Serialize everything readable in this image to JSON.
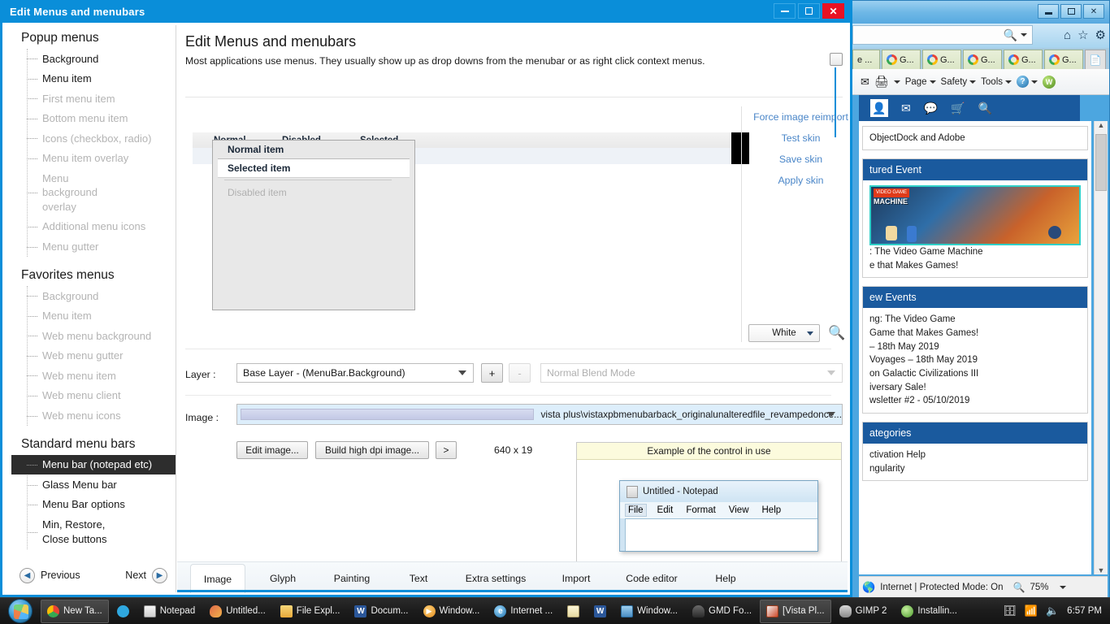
{
  "browser": {
    "tabs": [
      {
        "label": "e ...",
        "icon": "globe-icon"
      },
      {
        "label": "G...",
        "icon": "google-icon"
      },
      {
        "label": "G...",
        "icon": "google-icon"
      },
      {
        "label": "G...",
        "icon": "google-icon"
      },
      {
        "label": "G...",
        "icon": "google-icon"
      },
      {
        "label": "G...",
        "icon": "google-icon"
      }
    ],
    "command_bar": [
      "Page",
      "Safety",
      "Tools"
    ],
    "page": {
      "top_snippet": "ObjectDock and Adobe",
      "cards": [
        {
          "title": "tured Event",
          "has_image": true,
          "lines": [
            ": The Video Game Machine",
            "e that Makes Games!"
          ]
        },
        {
          "title": "ew Events",
          "has_image": false,
          "lines": [
            "ng: The Video Game",
            "Game that Makes Games!",
            "– 18th May 2019",
            "Voyages – 18th May 2019",
            " on Galactic Civilizations III",
            "iversary Sale!",
            "wsletter #2 - 05/10/2019"
          ]
        },
        {
          "title": "ategories",
          "has_image": false,
          "lines": [
            "ctivation Help",
            "ngularity"
          ]
        }
      ]
    },
    "status": {
      "zone": "Internet | Protected Mode: On",
      "zoom": "75%"
    }
  },
  "window": {
    "title": "Edit Menus and menubars",
    "minimize_label": "Minimize",
    "maximize_label": "Maximize",
    "close_label": "✕"
  },
  "sidebar": {
    "groups": [
      {
        "title": "Popup menus",
        "items": [
          {
            "label": "Background",
            "state": "normal"
          },
          {
            "label": "Menu item",
            "state": "normal"
          },
          {
            "label": "First menu item",
            "state": "dim"
          },
          {
            "label": "Bottom menu item",
            "state": "dim"
          },
          {
            "label": "Icons (checkbox, radio)",
            "state": "dim"
          },
          {
            "label": "Menu item overlay",
            "state": "dim"
          },
          {
            "label": "Menu background overlay",
            "state": "dim"
          },
          {
            "label": "Additional menu icons",
            "state": "dim"
          },
          {
            "label": "Menu gutter",
            "state": "dim"
          }
        ]
      },
      {
        "title": "Favorites menus",
        "items": [
          {
            "label": "Background",
            "state": "dim"
          },
          {
            "label": "Menu item",
            "state": "dim"
          },
          {
            "label": "Web menu background",
            "state": "dim"
          },
          {
            "label": "Web menu gutter",
            "state": "dim"
          },
          {
            "label": "Web menu item",
            "state": "dim"
          },
          {
            "label": "Web menu client",
            "state": "dim"
          },
          {
            "label": "Web menu icons",
            "state": "dim"
          }
        ]
      },
      {
        "title": "Standard menu bars",
        "items": [
          {
            "label": "Menu bar (notepad etc)",
            "state": "selected"
          },
          {
            "label": "Glass Menu bar",
            "state": "normal"
          },
          {
            "label": "Menu Bar options",
            "state": "normal"
          },
          {
            "label": "Min, Restore, Close buttons",
            "state": "normal"
          }
        ]
      }
    ],
    "nav": {
      "previous": "Previous",
      "next": "Next"
    }
  },
  "page": {
    "title": "Edit Menus and menubars",
    "subtitle": "Most applications use menus.  They usually show up as drop downs from the menubar or as right click context menus."
  },
  "preview": {
    "columns": [
      "Normal",
      "Disabled",
      "Selected"
    ],
    "menu_items": [
      {
        "label": "Normal item",
        "state": "normal"
      },
      {
        "label": "Selected item",
        "state": "selected"
      },
      {
        "label": "Disabled item",
        "state": "disabled"
      }
    ]
  },
  "skin_actions": [
    "Force image reimport",
    "Test skin",
    "Save skin",
    "Apply skin"
  ],
  "color_picker": {
    "value": "White",
    "magnifier_icon": "magnifier-icon"
  },
  "layer_row": {
    "label": "Layer :",
    "value": "Base Layer - (MenuBar.Background)",
    "add_label": "+",
    "remove_label": "-",
    "blend_placeholder": "Normal Blend Mode"
  },
  "image_row": {
    "label": "Image :",
    "path": "vista plus\\vistaxpbmenubarback_originalunalteredfile_revampedonce...",
    "edit_button": "Edit image...",
    "build_button": "Build high dpi image...",
    "more_button": ">",
    "dimensions": "640 x 19"
  },
  "example": {
    "header": "Example of the control in use",
    "notepad": {
      "title": "Untitled - Notepad",
      "menu": [
        "File",
        "Edit",
        "Format",
        "View",
        "Help"
      ],
      "active_menu": "File"
    }
  },
  "tabs": [
    {
      "label": "Image",
      "active": true
    },
    {
      "label": "Glyph",
      "active": false
    },
    {
      "label": "Painting",
      "active": false
    },
    {
      "label": "Text",
      "active": false
    },
    {
      "label": "Extra settings",
      "active": false
    },
    {
      "label": "Import",
      "active": false
    },
    {
      "label": "Code editor",
      "active": false
    },
    {
      "label": "Help",
      "active": false
    }
  ],
  "taskbar": {
    "items": [
      {
        "label": "New Ta...",
        "color": "#e8ac2a",
        "active": true
      },
      {
        "label": "",
        "color": "#2fa8e0",
        "active": false
      },
      {
        "label": "Notepad",
        "color": "#d8d8d8",
        "active": false
      },
      {
        "label": "Untitled...",
        "color": "#e06a4a",
        "active": false
      },
      {
        "label": "File Expl...",
        "color": "#f0c24a",
        "active": false
      },
      {
        "label": "Docum...",
        "color": "#2b579a",
        "active": false
      },
      {
        "label": "Window...",
        "color": "#e8972a",
        "active": false
      },
      {
        "label": "Internet ...",
        "color": "#2a8ad0",
        "active": false
      },
      {
        "label": "",
        "color": "#d8cba0",
        "active": false
      },
      {
        "label": "",
        "color": "#2b579a",
        "active": false
      },
      {
        "label": "Window...",
        "color": "#5a9ed0",
        "active": false
      },
      {
        "label": "GMD Fo...",
        "color": "#4a4a4a",
        "active": false
      },
      {
        "label": "[Vista Pl...",
        "color": "#d04a2a",
        "active": true
      },
      {
        "label": "GIMP 2",
        "color": "#8a8a8a",
        "active": false
      },
      {
        "label": "Installin...",
        "color": "#6ac44a",
        "active": false
      }
    ],
    "clock": "6:57 PM"
  }
}
